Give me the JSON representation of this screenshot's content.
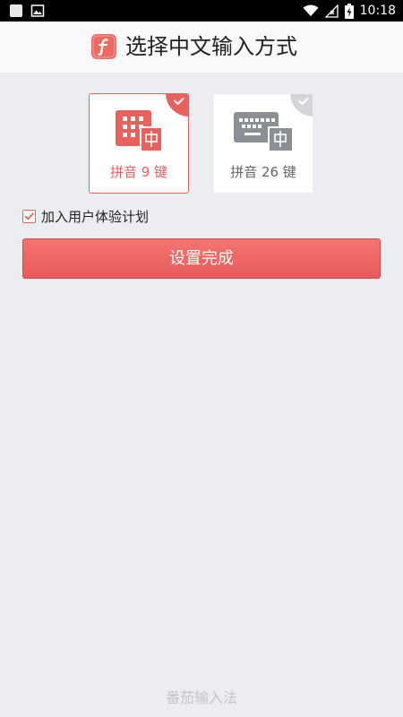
{
  "status_bar": {
    "time": "10:18",
    "icons": [
      "app-notification-icon",
      "image-notification-icon",
      "wifi-icon",
      "no-signal-icon",
      "battery-charging-icon"
    ]
  },
  "header": {
    "title": "选择中文输入方式",
    "logo_icon": "sogou-f-logo-icon"
  },
  "keyboard_options": [
    {
      "label": "拼音 9 键",
      "selected": true,
      "icon": "t9-keypad-icon"
    },
    {
      "label": "拼音 26 键",
      "selected": false,
      "icon": "qwerty-keyboard-icon"
    }
  ],
  "ux_plan": {
    "label": "加入用户体验计划",
    "checked": true
  },
  "done_button": {
    "label": "设置完成"
  },
  "footer": {
    "brand": "番茄输入法"
  },
  "colors": {
    "accent": "#e8615d",
    "background": "#ecedf1",
    "inactive_icon": "#8b8f96"
  }
}
